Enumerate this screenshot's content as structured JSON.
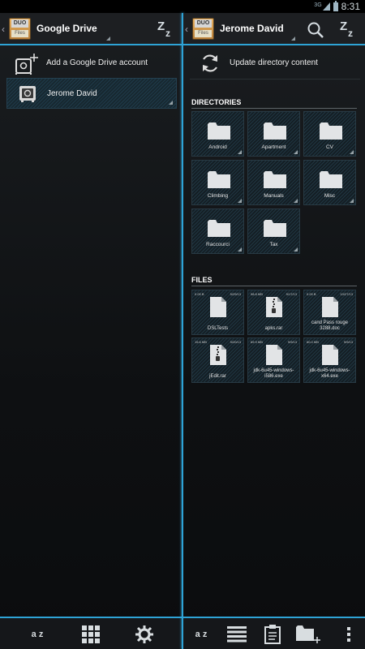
{
  "status_bar": {
    "network": "3G",
    "time": "8:31"
  },
  "app": {
    "logo_top": "DUO",
    "logo_bottom": "Files"
  },
  "left_pane": {
    "title": "Google Drive",
    "add_account_label": "Add a Google Drive account",
    "account_label": "Jerome David",
    "bottom": {
      "sort_label": "a z"
    }
  },
  "right_pane": {
    "title": "Jerome David",
    "update_label": "Update directory content",
    "directories_header": "DIRECTORIES",
    "directories": [
      "Android",
      "Apartment",
      "CV",
      "Climbing",
      "Manuals",
      "Misc",
      "Raccourci",
      "Tax"
    ],
    "files_header": "FILES",
    "files": [
      {
        "name": "DSLTests",
        "size": "0.00 B",
        "date": "5/29/13",
        "icon": "document-icon"
      },
      {
        "name": "apks.rar",
        "size": "98.8 MB",
        "date": "9/17/13",
        "icon": "zip-icon"
      },
      {
        "name": "cand Pass rouge 3288.doc",
        "size": "0.00 B",
        "date": "10/27/13",
        "icon": "document-icon"
      },
      {
        "name": "jEdit.rar",
        "size": "15.6 MB",
        "date": "9/20/13",
        "icon": "zip-icon"
      },
      {
        "name": "jdk-6u45-windows-i586.exe",
        "size": "69.9 MB",
        "date": "9/9/13",
        "icon": "document-icon"
      },
      {
        "name": "jdk-6u45-windows-x64.exe",
        "size": "60.0 MB",
        "date": "9/9/13",
        "icon": "document-icon"
      }
    ],
    "bottom": {
      "sort_label": "a z"
    }
  },
  "colors": {
    "accent": "#2ea3d6",
    "background": "#0e1012",
    "tile": "#1a2a32"
  }
}
